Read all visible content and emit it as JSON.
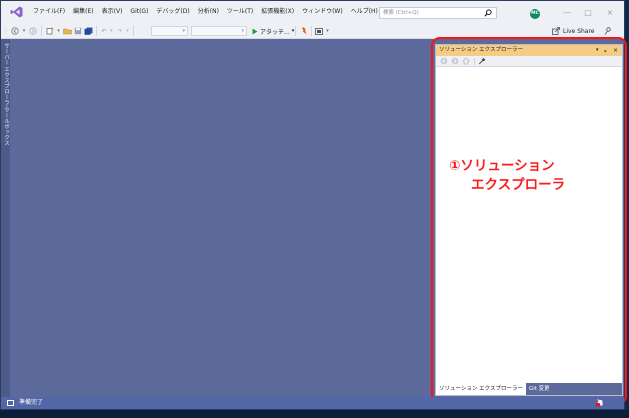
{
  "window": {
    "menu": [
      "ファイル(F)",
      "編集(E)",
      "表示(V)",
      "Git(G)",
      "デバッグ(D)",
      "分析(N)",
      "ツール(T)",
      "拡張機能(X)",
      "ウィンドウ(W)",
      "ヘルプ(H)"
    ],
    "search_placeholder": "検索 (Ctrl+Q)",
    "avatar_initials": "MC",
    "minimize": "—",
    "maximize": "□",
    "close": "×"
  },
  "toolbar": {
    "run_label": "アタッチ...",
    "live_share_label": "Live Share"
  },
  "left_tabs": {
    "server_explorer": "サーバー エクスプローラー",
    "toolbox": "ツールボックス"
  },
  "solution_explorer": {
    "title": "ソリューション エクスプローラー",
    "pin": "ᵩ",
    "dropdown": "▾",
    "close": "×",
    "tabs": [
      "ソリューション エクスプローラー",
      "Git 変更"
    ]
  },
  "annotation": {
    "line1": "①ソリューション",
    "line2": "エクスプローラ",
    "color": "#ff1a1a"
  },
  "statusbar": {
    "text": "準備完了",
    "notification_count": "1"
  },
  "colors": {
    "editor_bg": "#5b6a9b",
    "chrome_bg": "#eef0f6",
    "active_panel_header": "#f5cc84",
    "statusbar": "#5266a8"
  }
}
